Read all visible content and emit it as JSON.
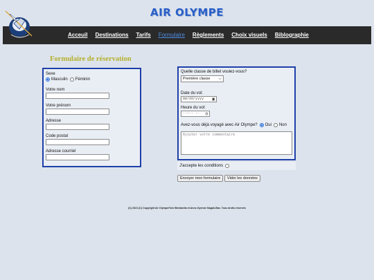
{
  "site": {
    "title": "AIR OLYMPE"
  },
  "nav": {
    "items": [
      {
        "label": "Acceuil"
      },
      {
        "label": "Destinations"
      },
      {
        "label": "Tarifs"
      },
      {
        "label": "Formulaire",
        "active": true
      },
      {
        "label": "Règlements"
      },
      {
        "label": "Choix visuels"
      },
      {
        "label": "Biblographie"
      }
    ]
  },
  "form": {
    "heading": "Formulaire de réservation",
    "sex": {
      "label": "Sexe",
      "options": [
        "Masculin",
        "Féminin"
      ],
      "selected": "Masculin"
    },
    "fields": {
      "nom": {
        "label": "Votre nom",
        "value": ""
      },
      "prenom": {
        "label": "Votre prénom",
        "value": ""
      },
      "adresse": {
        "label": "Adresse",
        "value": ""
      },
      "code_postal": {
        "label": "Code postal",
        "value": ""
      },
      "courriel": {
        "label": "Adresse courriel",
        "value": ""
      }
    },
    "ticket": {
      "label": "Quelle classe de billet voulez-vous?",
      "selected": "Première classe"
    },
    "date": {
      "label": "Date du vol:",
      "placeholder": "mm/dd/yyyy"
    },
    "time": {
      "label": "Heure du vol:",
      "placeholder": "--:-- --"
    },
    "travelled": {
      "label": "Avez-vous déjà voyagé avec Air Olympe?",
      "options": [
        "Oui",
        "Non"
      ],
      "selected": "Oui"
    },
    "comment": {
      "placeholder": "Ajouter votre commentaire"
    },
    "consent": {
      "label": "J'accepte les conditions"
    },
    "buttons": {
      "submit": "Envoyer mon formulaire",
      "reset": "Vider les données"
    }
  },
  "footer": {
    "text": "(C) 2021 (C) Copyright Air Olympe/Yoni Beniamlia et Anne-Gyenne Nagah-Bas. Tous droits réservés"
  },
  "colors": {
    "title": "#2a5fc7",
    "navbar": "#2a2a2a",
    "heading": "#b3b02a",
    "panel_border": "#1e3fa8",
    "background": "#dde3ec"
  }
}
